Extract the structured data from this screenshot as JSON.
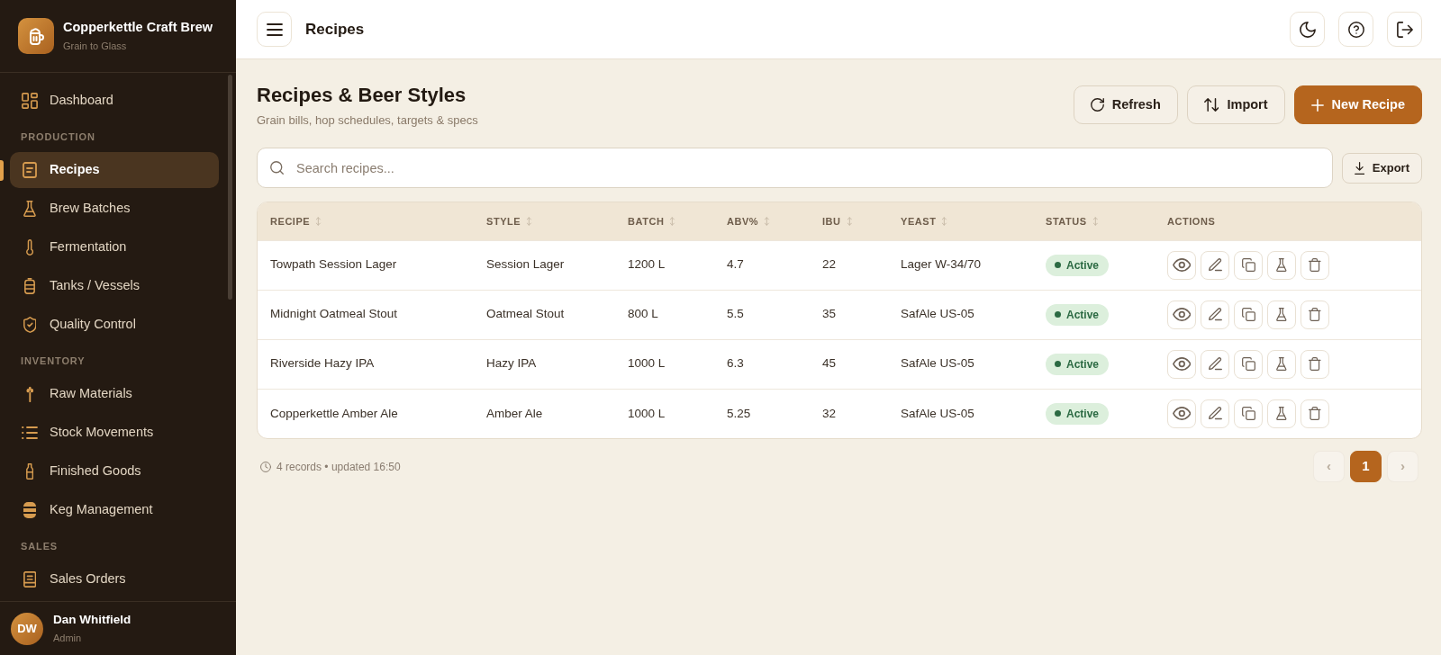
{
  "sidebar": {
    "brand": {
      "name": "Copperkettle Craft Brew",
      "tagline": "Grain to Glass"
    },
    "sections": [
      {
        "items": [
          {
            "label": "Dashboard",
            "selected": false
          }
        ]
      },
      {
        "heading": "PRODUCTION",
        "items": [
          {
            "label": "Recipes",
            "selected": true
          },
          {
            "label": "Brew Batches",
            "selected": false
          },
          {
            "label": "Fermentation",
            "selected": false
          },
          {
            "label": "Tanks / Vessels",
            "selected": false
          },
          {
            "label": "Quality Control",
            "selected": false
          }
        ]
      },
      {
        "heading": "INVENTORY",
        "items": [
          {
            "label": "Raw Materials",
            "selected": false
          },
          {
            "label": "Stock Movements",
            "selected": false
          },
          {
            "label": "Finished Goods",
            "selected": false
          },
          {
            "label": "Keg Management",
            "selected": false
          }
        ]
      },
      {
        "heading": "SALES",
        "items": [
          {
            "label": "Sales Orders",
            "selected": false
          }
        ]
      }
    ],
    "user": {
      "initials": "DW",
      "name": "Dan Whitfield",
      "role": "Admin"
    }
  },
  "header": {
    "title": "Recipes"
  },
  "page": {
    "title": "Recipes & Beer Styles",
    "subtitle": "Grain bills, hop schedules, targets & specs",
    "actions": [
      {
        "label": "Refresh",
        "kind": "outline"
      },
      {
        "label": "Import",
        "kind": "outline"
      },
      {
        "label": "New Recipe",
        "kind": "primary"
      }
    ]
  },
  "search": {
    "placeholder": "Search recipes..."
  },
  "export": {
    "label": "Export"
  },
  "table": {
    "columns": [
      {
        "label": "RECIPE",
        "sortable": true
      },
      {
        "label": "STYLE",
        "sortable": true
      },
      {
        "label": "BATCH",
        "sortable": true
      },
      {
        "label": "ABV%",
        "sortable": true
      },
      {
        "label": "IBU",
        "sortable": true
      },
      {
        "label": "YEAST",
        "sortable": true
      },
      {
        "label": "STATUS",
        "sortable": true
      },
      {
        "label": "ACTIONS",
        "sortable": false
      }
    ],
    "rows": [
      {
        "cells": [
          "Towpath Session Lager",
          "Session Lager",
          "1200 L",
          "4.7",
          "22",
          "Lager W-34/70"
        ],
        "status": "Active"
      },
      {
        "cells": [
          "Midnight Oatmeal Stout",
          "Oatmeal Stout",
          "800 L",
          "5.5",
          "35",
          "SafAle US-05"
        ],
        "status": "Active"
      },
      {
        "cells": [
          "Riverside Hazy IPA",
          "Hazy IPA",
          "1000 L",
          "6.3",
          "45",
          "SafAle US-05"
        ],
        "status": "Active"
      },
      {
        "cells": [
          "Copperkettle Amber Ale",
          "Amber Ale",
          "1000 L",
          "5.25",
          "32",
          "SafAle US-05"
        ],
        "status": "Active"
      }
    ]
  },
  "footer": {
    "summary": "4 records • updated 16:50",
    "pagination": {
      "prev": {
        "label": "‹",
        "disabled": true
      },
      "pages": [
        {
          "label": "1",
          "selected": true
        }
      ],
      "next": {
        "label": "›",
        "disabled": true
      }
    }
  }
}
